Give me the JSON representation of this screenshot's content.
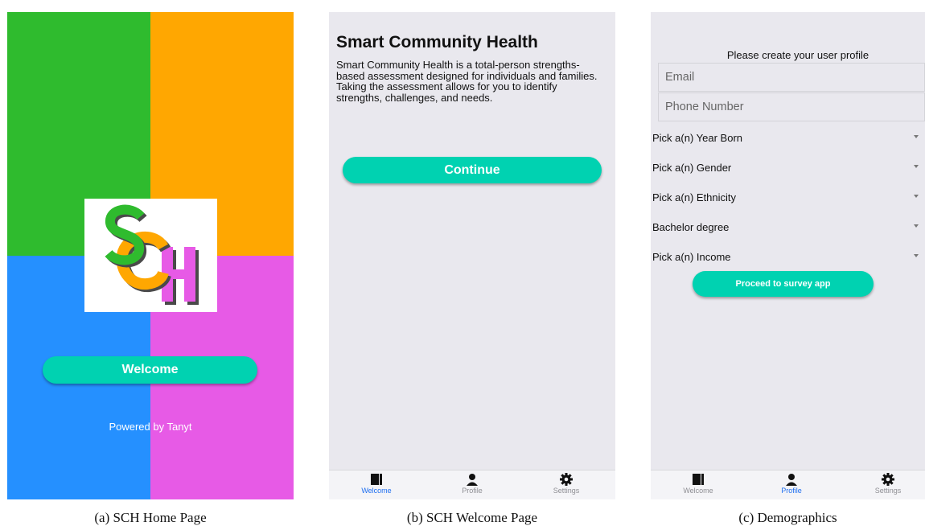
{
  "panel_a": {
    "welcome_label": "Welcome",
    "powered": "Powered by Tanyt",
    "colors": {
      "green": "#2fbb2e",
      "orange": "#ffa701",
      "blue": "#2590ff",
      "pink": "#e75ae6",
      "button": "#00d2b1"
    }
  },
  "panel_b": {
    "title": "Smart Community Health",
    "description": "Smart Community Health is a total-person strengths-based assessment designed for individuals and families. Taking the assessment allows for you to identify strengths, challenges, and needs.",
    "continue_label": "Continue"
  },
  "panel_c": {
    "heading": "Please create your user profile",
    "email_placeholder": "Email",
    "phone_placeholder": "Phone Number",
    "pickers": [
      "Pick a(n) Year Born",
      "Pick a(n) Gender",
      "Pick a(n) Ethnicity",
      "Bachelor degree",
      "Pick a(n) Income"
    ],
    "proceed_label": "Proceed to survey app"
  },
  "tabs": {
    "welcome": "Welcome",
    "profile": "Profile",
    "settings": "Settings"
  },
  "captions": {
    "a": "(a) SCH Home Page",
    "b": "(b) SCH Welcome Page",
    "c": "(c) Demographics"
  }
}
